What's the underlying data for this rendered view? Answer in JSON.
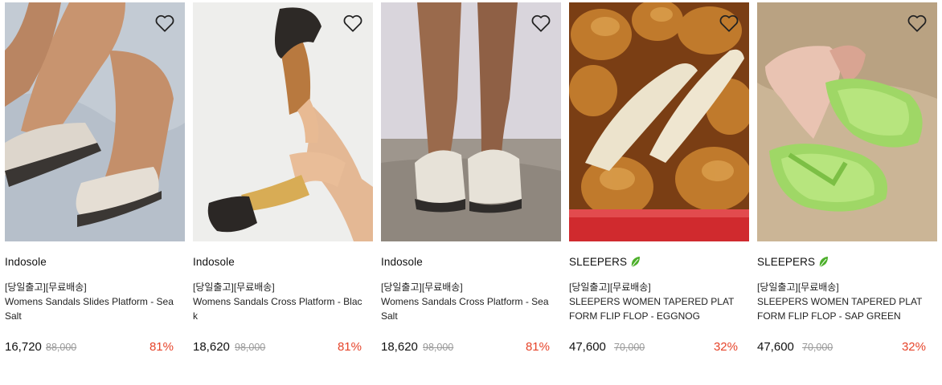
{
  "products": [
    {
      "brand": "Indosole",
      "eco": false,
      "tag": "[당일출고][무료배송]",
      "name": "Womens Sandals Slides Platform - Sea Salt",
      "price": "16,720",
      "original_price": "88,000",
      "discount": "81%"
    },
    {
      "brand": "Indosole",
      "eco": false,
      "tag": "[당일출고][무료배송]",
      "name": "Womens Sandals Cross Platform - Black",
      "price": "18,620",
      "original_price": "98,000",
      "discount": "81%"
    },
    {
      "brand": "Indosole",
      "eco": false,
      "tag": "[당일출고][무료배송]",
      "name": "Womens Sandals Cross Platform - Sea Salt",
      "price": "18,620",
      "original_price": "98,000",
      "discount": "81%"
    },
    {
      "brand": "SLEEPERS",
      "eco": true,
      "tag": "[당일출고][무료배송]",
      "name": "SLEEPERS WOMEN TAPERED PLATFORM FLIP FLOP - EGGNOG",
      "price": "47,600",
      "original_price": "70,000",
      "discount": "32%"
    },
    {
      "brand": "SLEEPERS",
      "eco": true,
      "tag": "[당일출고][무료배송]",
      "name": "SLEEPERS WOMEN TAPERED PLATFORM FLIP FLOP - SAP GREEN",
      "price": "47,600",
      "original_price": "70,000",
      "discount": "32%"
    }
  ],
  "colors": {
    "discount": "#e6442a",
    "original_price": "#999999",
    "eco_leaf": "#4caf2a"
  },
  "icons": {
    "wishlist": "heart-outline-icon",
    "eco": "leaf-icon"
  }
}
